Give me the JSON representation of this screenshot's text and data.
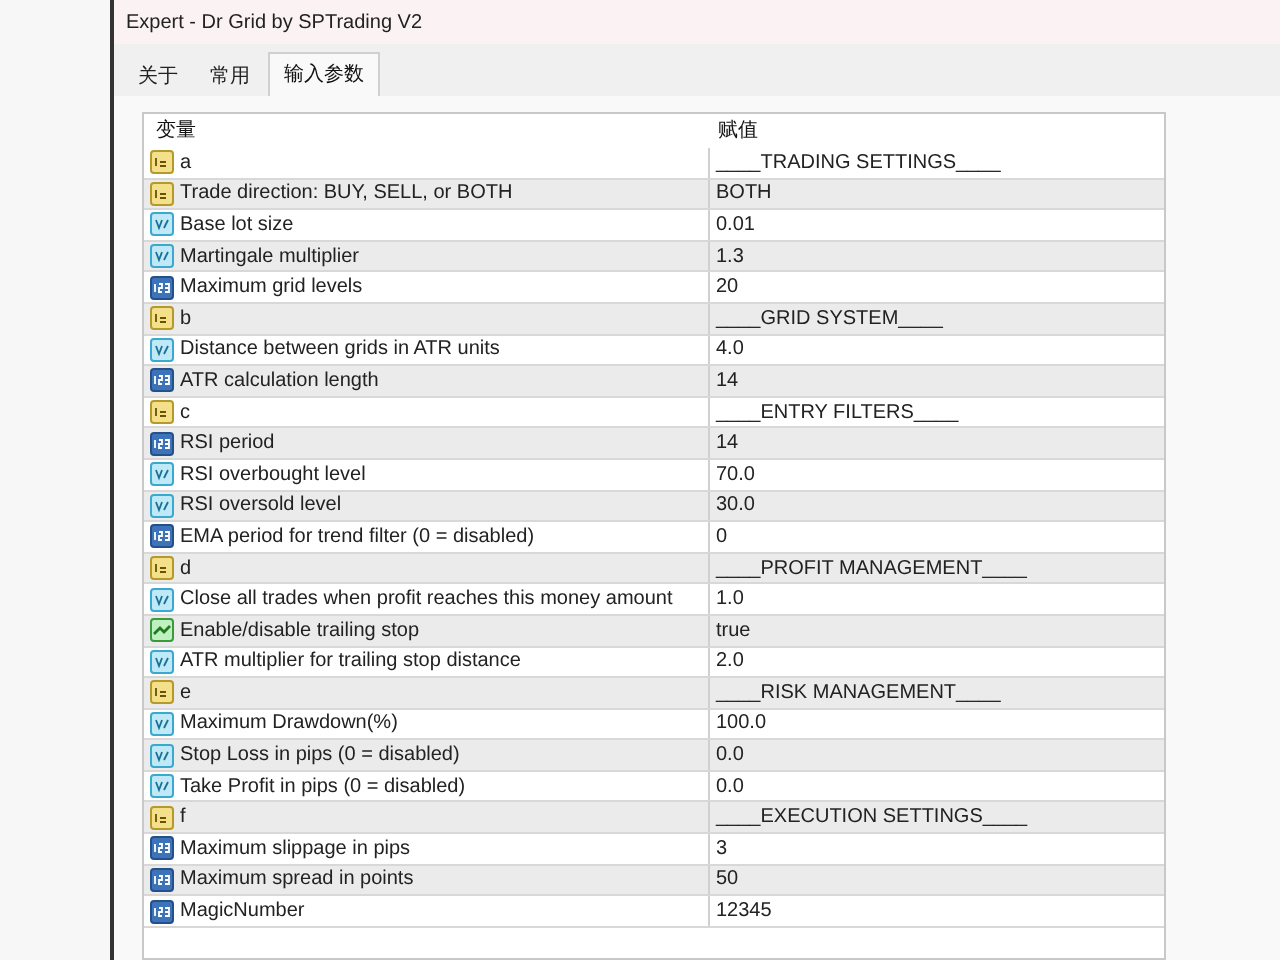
{
  "window": {
    "title": "Expert - Dr Grid by SPTrading V2"
  },
  "tabs": [
    {
      "label": "关于",
      "selected": false
    },
    {
      "label": "常用",
      "selected": false
    },
    {
      "label": "输入参数",
      "selected": true
    }
  ],
  "table": {
    "columns": [
      "变量",
      "赋值"
    ],
    "rows": [
      {
        "kind": "string",
        "name": "a",
        "value": "____TRADING SETTINGS____"
      },
      {
        "kind": "string",
        "name": "Trade direction: BUY, SELL, or BOTH",
        "value": "BOTH"
      },
      {
        "kind": "double",
        "name": "Base lot size",
        "value": "0.01"
      },
      {
        "kind": "double",
        "name": "Martingale multiplier",
        "value": "1.3"
      },
      {
        "kind": "int",
        "name": "Maximum grid levels",
        "value": "20"
      },
      {
        "kind": "string",
        "name": "b",
        "value": "____GRID SYSTEM____"
      },
      {
        "kind": "double",
        "name": "Distance between grids in ATR units",
        "value": "4.0"
      },
      {
        "kind": "int",
        "name": "ATR calculation length",
        "value": "14"
      },
      {
        "kind": "string",
        "name": "c",
        "value": "____ENTRY FILTERS____"
      },
      {
        "kind": "int",
        "name": "RSI period",
        "value": "14"
      },
      {
        "kind": "double",
        "name": "RSI overbought level",
        "value": "70.0"
      },
      {
        "kind": "double",
        "name": "RSI oversold level",
        "value": "30.0"
      },
      {
        "kind": "int",
        "name": "EMA period for trend filter (0 = disabled)",
        "value": "0"
      },
      {
        "kind": "string",
        "name": "d",
        "value": "____PROFIT MANAGEMENT____"
      },
      {
        "kind": "double",
        "name": "Close all trades when profit reaches this money amount",
        "value": "1.0"
      },
      {
        "kind": "bool",
        "name": "Enable/disable trailing stop",
        "value": "true"
      },
      {
        "kind": "double",
        "name": "ATR multiplier for trailing stop distance",
        "value": "2.0"
      },
      {
        "kind": "string",
        "name": "e",
        "value": "____RISK MANAGEMENT____"
      },
      {
        "kind": "double",
        "name": "Maximum Drawdown(%)",
        "value": "100.0"
      },
      {
        "kind": "double",
        "name": "Stop Loss in pips (0 = disabled)",
        "value": "0.0"
      },
      {
        "kind": "double",
        "name": "Take Profit in pips (0 = disabled)",
        "value": "0.0"
      },
      {
        "kind": "string",
        "name": "f",
        "value": "____EXECUTION SETTINGS____"
      },
      {
        "kind": "int",
        "name": "Maximum slippage in pips",
        "value": "3"
      },
      {
        "kind": "int",
        "name": "Maximum spread in points",
        "value": "50"
      },
      {
        "kind": "int",
        "name": "MagicNumber",
        "value": "12345"
      }
    ]
  }
}
